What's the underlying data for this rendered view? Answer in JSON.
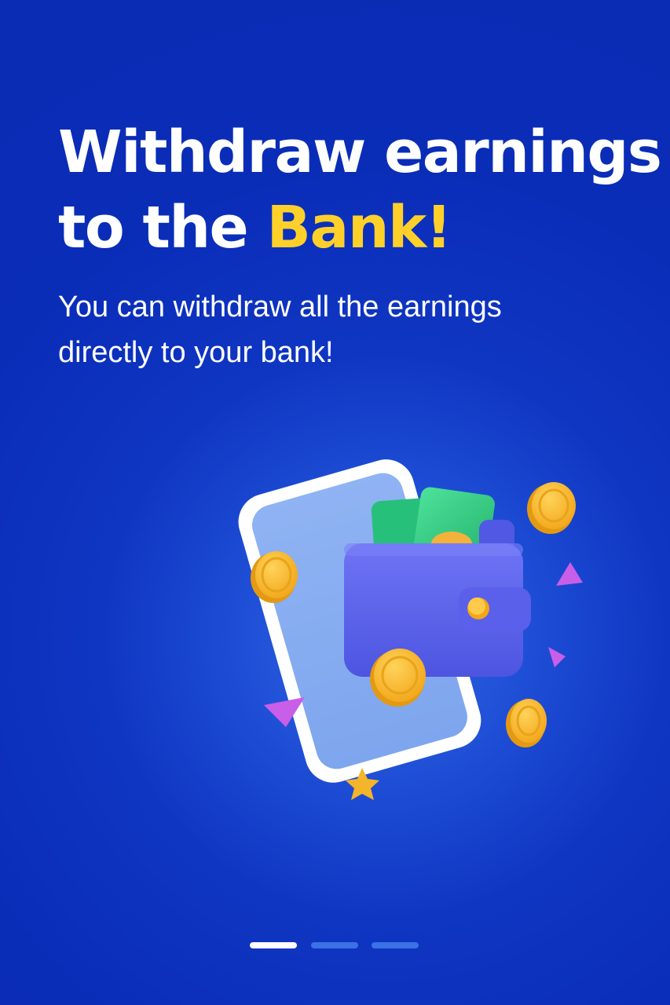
{
  "onboarding": {
    "headline": {
      "line1": "Withdraw earnings",
      "line2_prefix": "to the ",
      "line2_accent": "Bank!"
    },
    "subtitle": {
      "line1": "You can withdraw all the earnings",
      "line2": "directly to your bank!"
    },
    "illustration_icon": "phone-wallet-coins-illustration",
    "pager": {
      "total_pages": 3,
      "active_index": 0
    }
  },
  "colors": {
    "background": "#0a2db8",
    "accent": "#ffd02a",
    "text": "#ffffff",
    "pager_inactive": "#3a72e6",
    "pager_active": "#ffffff"
  }
}
